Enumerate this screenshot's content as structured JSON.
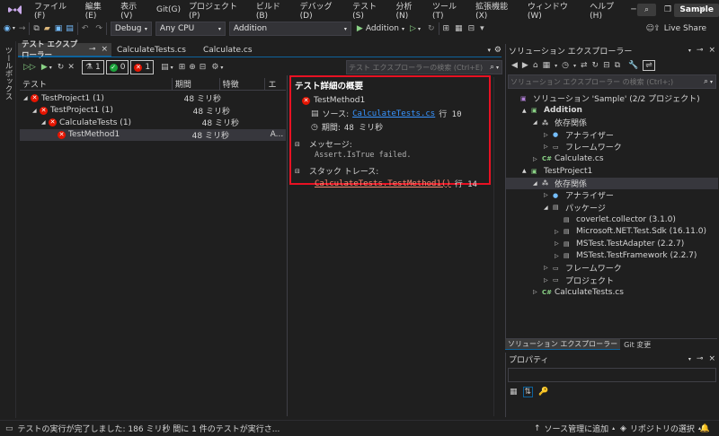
{
  "menubar": {
    "items": [
      "ファイル(F)",
      "編集(E)",
      "表示(V)",
      "Git(G)",
      "プロジェクト(P)",
      "ビルド(B)",
      "デバッグ(D)",
      "テスト(S)",
      "分析(N)",
      "ツール(T)",
      "拡張機能(X)",
      "ウィンドウ(W)",
      "ヘルプ(H)"
    ],
    "search_glyph": "⌕",
    "solution_name": "Sample"
  },
  "toolbar": {
    "config": "Debug",
    "platform": "Any CPU",
    "startup_project": "Addition",
    "run_label": "Addition",
    "live_share": "Live Share"
  },
  "left_strip": {
    "label": "ツールボックス"
  },
  "tabs": [
    {
      "label": "テスト エクスプローラー",
      "pin": "⊸",
      "close": "×"
    },
    {
      "label": "CalculateTests.cs"
    },
    {
      "label": "Calculate.cs"
    }
  ],
  "test_explorer": {
    "counts": {
      "total": "1",
      "passed": "0",
      "failed": "1"
    },
    "search_placeholder": "テスト エクスプローラーの検索 (Ctrl+E)",
    "columns": [
      "テスト",
      "期間",
      "特徴",
      "エ"
    ],
    "rows": [
      {
        "name": "TestProject1 (1)",
        "duration": "48 ミリ秒",
        "trait": "",
        "extra": "",
        "indent": 0
      },
      {
        "name": "TestProject1 (1)",
        "duration": "48 ミリ秒",
        "trait": "",
        "extra": "",
        "indent": 1
      },
      {
        "name": "CalculateTests (1)",
        "duration": "48 ミリ秒",
        "trait": "",
        "extra": "",
        "indent": 2
      },
      {
        "name": "TestMethod1",
        "duration": "48 ミリ秒",
        "trait": "",
        "extra": "A...",
        "indent": 3
      }
    ]
  },
  "detail": {
    "heading": "テスト詳細の概要",
    "test_name": "TestMethod1",
    "source_label": "ソース:",
    "source_file": "CalculateTests.cs",
    "source_line": "行 10",
    "duration_label": "期間:",
    "duration_value": "48 ミリ秒",
    "message_label": "メッセージ:",
    "message_text": "Assert.IsTrue failed.",
    "stack_label": "スタック トレース:",
    "stack_link": "CalculateTests.TestMethod1()",
    "stack_line": "行 14",
    "highlight_color": "#e81123"
  },
  "solution_explorer": {
    "title": "ソリューション エクスプローラー",
    "search_placeholder": "ソリューション エクスプローラー の検索 (Ctrl+;)",
    "items": [
      {
        "label": "ソリューション 'Sample' (2/2 プロジェクト)",
        "indent": 0,
        "arrow": "",
        "icon": "sln"
      },
      {
        "label": "Addition",
        "indent": 1,
        "arrow": "▲",
        "icon": "proj",
        "bold": true
      },
      {
        "label": "依存関係",
        "indent": 2,
        "arrow": "◢",
        "icon": "deps"
      },
      {
        "label": "アナライザー",
        "indent": 3,
        "arrow": "▷",
        "icon": "analyzer"
      },
      {
        "label": "フレームワーク",
        "indent": 3,
        "arrow": "▷",
        "icon": "framework"
      },
      {
        "label": "Calculate.cs",
        "indent": 2,
        "arrow": "▷",
        "icon": "cs"
      },
      {
        "label": "TestProject1",
        "indent": 1,
        "arrow": "▲",
        "icon": "testproj"
      },
      {
        "label": "依存関係",
        "indent": 2,
        "arrow": "◢",
        "icon": "deps",
        "selected": true
      },
      {
        "label": "アナライザー",
        "indent": 3,
        "arrow": "▷",
        "icon": "analyzer"
      },
      {
        "label": "パッケージ",
        "indent": 3,
        "arrow": "◢",
        "icon": "package"
      },
      {
        "label": "coverlet.collector (3.1.0)",
        "indent": 4,
        "arrow": "",
        "icon": "package"
      },
      {
        "label": "Microsoft.NET.Test.Sdk (16.11.0)",
        "indent": 4,
        "arrow": "▷",
        "icon": "package"
      },
      {
        "label": "MSTest.TestAdapter (2.2.7)",
        "indent": 4,
        "arrow": "▷",
        "icon": "package"
      },
      {
        "label": "MSTest.TestFramework (2.2.7)",
        "indent": 4,
        "arrow": "▷",
        "icon": "package"
      },
      {
        "label": "フレームワーク",
        "indent": 3,
        "arrow": "▷",
        "icon": "framework"
      },
      {
        "label": "プロジェクト",
        "indent": 3,
        "arrow": "▷",
        "icon": "project-ref"
      },
      {
        "label": "CalculateTests.cs",
        "indent": 2,
        "arrow": "▷",
        "icon": "cs"
      }
    ],
    "bottom_tabs": [
      "ソリューション エクスプローラー",
      "Git 変更"
    ]
  },
  "properties": {
    "title": "プロパティ"
  },
  "statusbar": {
    "message": "テストの実行が完了しました: 186 ミリ秒 間に 1 件のテストが実行さ...",
    "source_control": "ソース管理に追加",
    "repository": "リポジトリの選択",
    "bell": "🔔"
  }
}
